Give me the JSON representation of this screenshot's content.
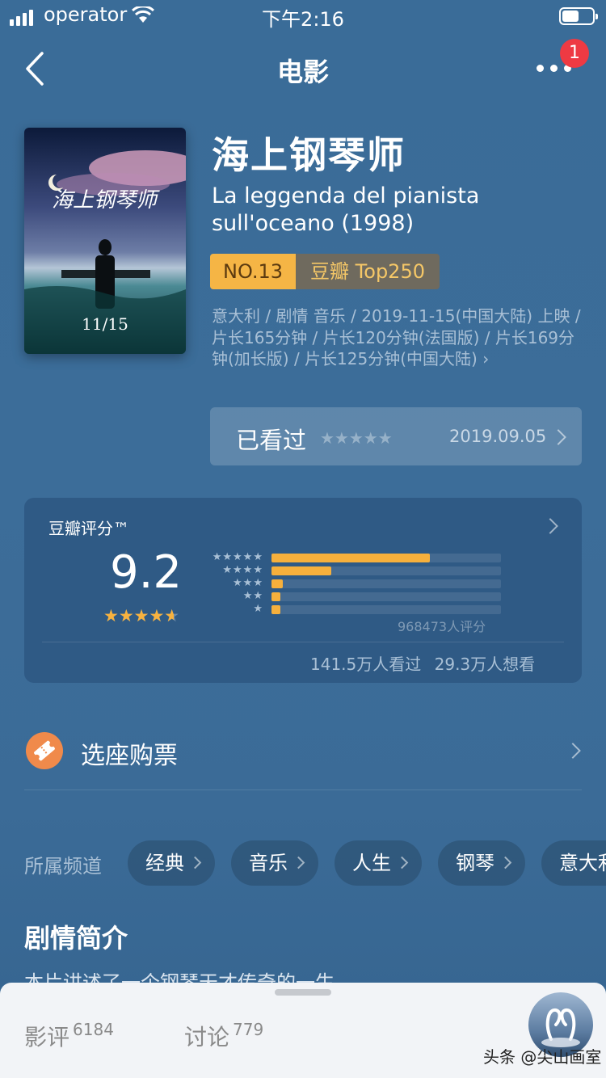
{
  "status_bar": {
    "carrier": "operator",
    "time": "下午2:16"
  },
  "nav": {
    "title": "电影",
    "badge": "1"
  },
  "movie": {
    "title": "海上钢琴师",
    "original_title": "La leggenda del pianista sull'oceano (1998)",
    "rank_no": "NO.13",
    "rank_list": "豆瓣 Top250",
    "meta": "意大利 / 剧情 音乐 / 2019-11-15(中国大陆) 上映 / 片长165分钟 / 片长120分钟(法国版) / 片长169分钟(加长版) / 片长125分钟(中国大陆)",
    "meta_arrow": "›"
  },
  "poster": {
    "date_text": "11/15"
  },
  "watched": {
    "label": "已看过",
    "stars": "★★★★★",
    "date": "2019.09.05"
  },
  "rating": {
    "label": "豆瓣评分™",
    "score": "9.2",
    "score_stars": "★★★★★",
    "star_value": 4.6,
    "distribution_labels": [
      "★★★★★",
      "★★★★",
      "★★★",
      "★★",
      "★"
    ],
    "distribution_fractions": [
      0.69,
      0.26,
      0.05,
      0.04,
      0.04
    ],
    "count": "968473人评分",
    "watched_count": "141.5万人看过",
    "want_count": "29.3万人想看"
  },
  "ticket": {
    "label": "选座购票"
  },
  "channels": {
    "title": "所属频道",
    "items": [
      "经典",
      "音乐",
      "人生",
      "钢琴",
      "意大利"
    ]
  },
  "synopsis": {
    "title": "剧情简介",
    "text_preview": "本片讲述了一个钢琴天才传奇的一生"
  },
  "bottom_sheet": {
    "tabs": [
      {
        "label": "影评",
        "count": "6184"
      },
      {
        "label": "讨论",
        "count": "779"
      }
    ]
  },
  "watermark": "头条 @尖山画室",
  "colors": {
    "background": "#3b6c98",
    "accent": "#f6b03c",
    "badge": "#ee3a43",
    "ticket": "#f08a4b"
  },
  "icons": [
    "back-icon",
    "more-icon",
    "chevron-right-icon",
    "ticket-icon",
    "wifi-icon",
    "battery-icon",
    "signal-icon"
  ]
}
